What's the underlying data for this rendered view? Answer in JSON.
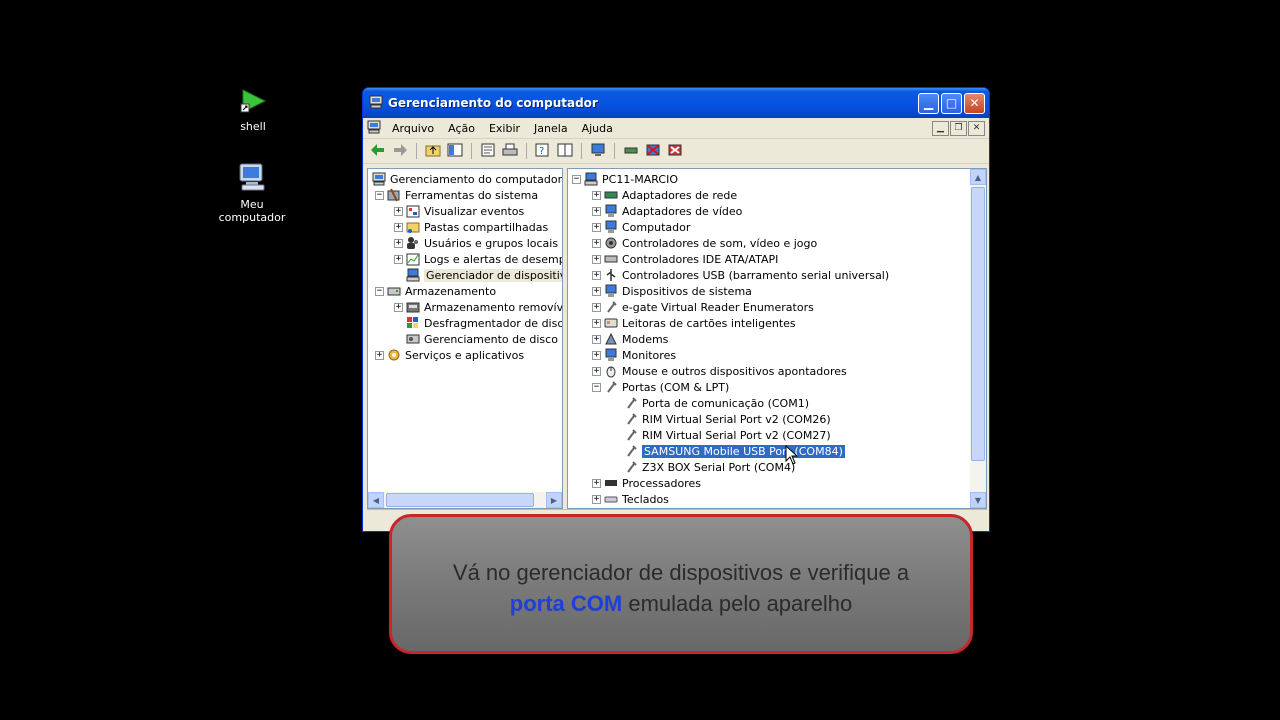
{
  "desktop": {
    "icons": [
      {
        "label": "shell",
        "icon": "green-arrow-icon"
      },
      {
        "label": "Meu computador",
        "icon": "computer-icon"
      }
    ]
  },
  "window": {
    "title": "Gerenciamento do computador",
    "menu": [
      "Arquivo",
      "Ação",
      "Exibir",
      "Janela",
      "Ajuda"
    ],
    "left_tree": [
      "Gerenciamento do computador (loca",
      "Ferramentas do sistema",
      "Visualizar eventos",
      "Pastas compartilhadas",
      "Usuários e grupos locais",
      "Logs e alertas de desempen",
      "Gerenciador de dispositivos",
      "Armazenamento",
      "Armazenamento removível",
      "Desfragmentador de disco",
      "Gerenciamento de disco",
      "Serviços e aplicativos"
    ],
    "right_tree": [
      "PC11-MARCIO",
      "Adaptadores de rede",
      "Adaptadores de vídeo",
      "Computador",
      "Controladores de som, vídeo e jogo",
      "Controladores IDE ATA/ATAPI",
      "Controladores USB (barramento serial universal)",
      "Dispositivos de sistema",
      "e-gate Virtual Reader Enumerators",
      "Leitoras de cartões inteligentes",
      "Modems",
      "Monitores",
      "Mouse e outros dispositivos apontadores",
      "Portas (COM & LPT)",
      "Porta de comunicação (COM1)",
      "RIM Virtual Serial Port v2 (COM26)",
      "RIM Virtual Serial Port v2 (COM27)",
      "SAMSUNG Mobile USB Port (COM84)",
      "Z3X BOX Serial Port (COM4)",
      "Processadores",
      "Teclados"
    ]
  },
  "caption": {
    "line1": "Vá no gerenciador de dispositivos e verifique a",
    "emphasis": "porta COM",
    "line2_rest": " emulada pelo aparelho",
    "border_color": "#C8262A",
    "emphasis_color": "#1E3FD8"
  }
}
